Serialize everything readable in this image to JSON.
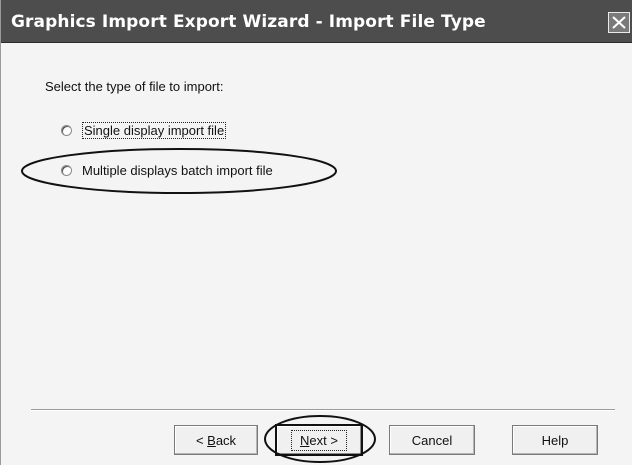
{
  "window": {
    "title": "Graphics Import Export Wizard - Import File Type"
  },
  "content": {
    "prompt": "Select the type of file to import:",
    "options": [
      {
        "label": "Single display import file",
        "selected": false
      },
      {
        "label": "Multiple displays batch import file",
        "selected": false
      }
    ]
  },
  "buttons": {
    "back": {
      "mnemonic": "B",
      "rest": "ack",
      "prefix": "< "
    },
    "next": {
      "mnemonic": "N",
      "rest": "ext >"
    },
    "cancel": "Cancel",
    "help": "Help"
  },
  "icons": {
    "close": "close-icon"
  }
}
